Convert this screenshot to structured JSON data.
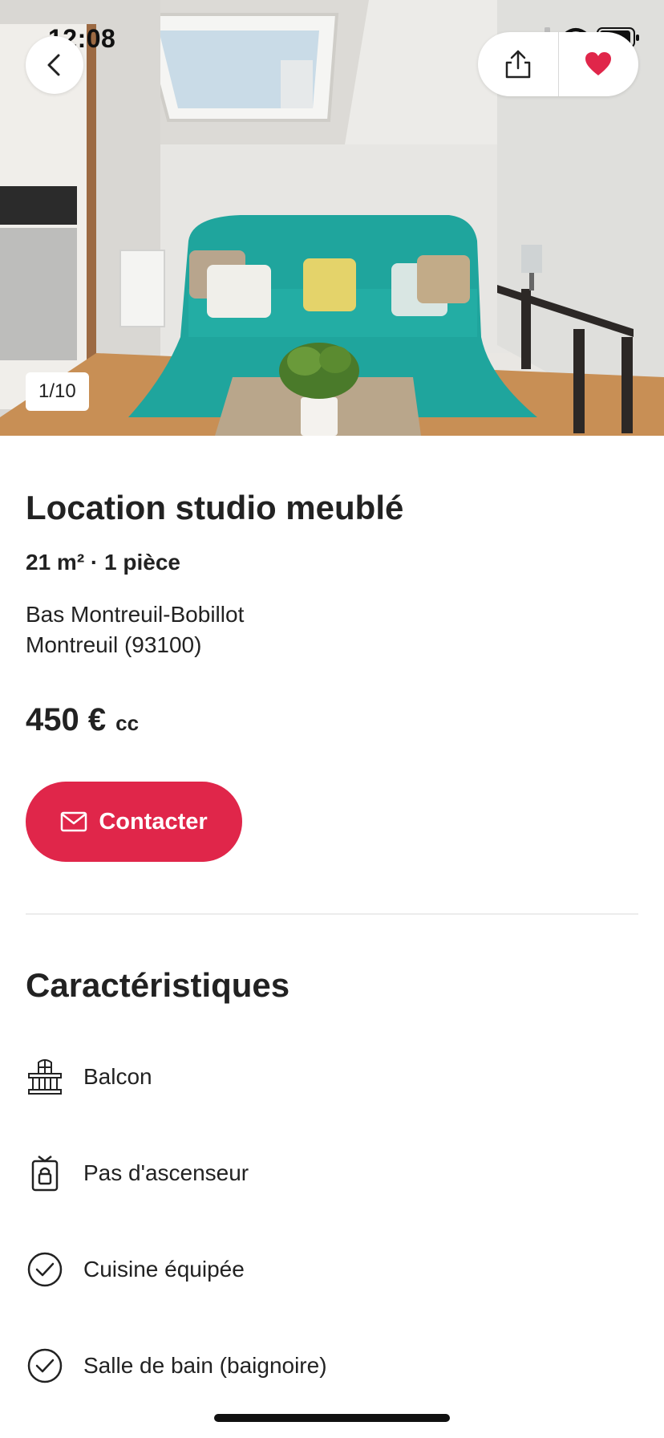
{
  "status_bar": {
    "time": "12:08"
  },
  "header": {
    "photo_counter": "1/10",
    "icons": {
      "back": "chevron-left-icon",
      "share": "share-icon",
      "favorite": "heart-icon"
    },
    "favorite_color": "#e0264a"
  },
  "listing": {
    "title": "Location studio meublé",
    "specs": "21 m² · 1 pièce",
    "address_line1": "Bas Montreuil-Bobillot",
    "address_line2": "Montreuil (93100)",
    "price": "450 €",
    "price_unit": "cc"
  },
  "contact_button": {
    "label": "Contacter",
    "color": "#e0264a",
    "icon": "mail-icon"
  },
  "characteristics": {
    "title": "Caractéristiques",
    "items": [
      {
        "label": "Balcon",
        "icon": "balcony-icon"
      },
      {
        "label": "Pas d'ascenseur",
        "icon": "elevator-icon"
      },
      {
        "label": "Cuisine équipée",
        "icon": "check-circle-icon"
      },
      {
        "label": "Salle de bain (baignoire)",
        "icon": "check-circle-icon"
      }
    ]
  }
}
